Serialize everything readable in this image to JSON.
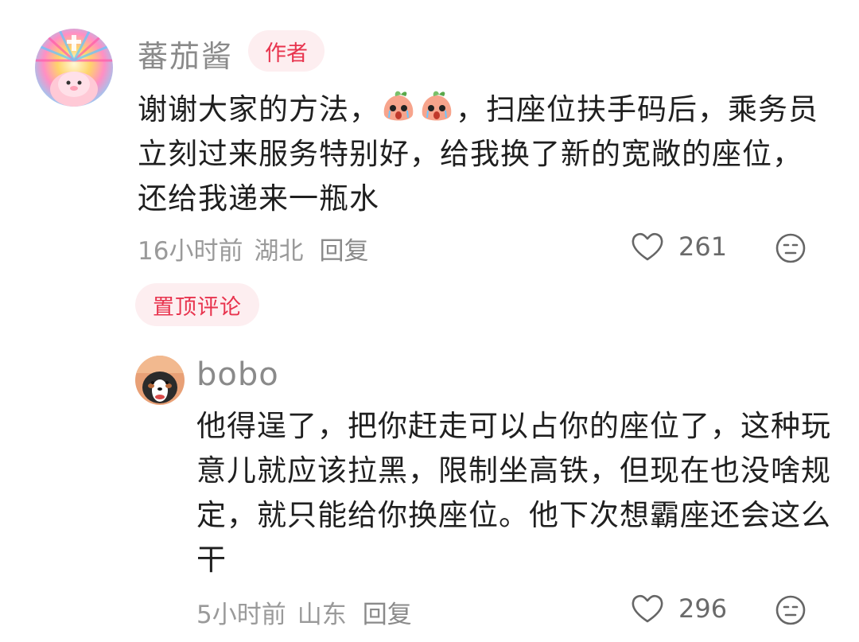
{
  "comment": {
    "author_name": "蕃茄酱",
    "author_badge": "作者",
    "text_part1": "谢谢大家的方法，",
    "text_part2": "，扫座位扶手码后，乘务员立刻过来服务特别好，给我换了新的宽敞的座位，还给我递来一瓶水",
    "time": "16小时前",
    "location": "湖北",
    "reply_label": "回复",
    "like_count": "261",
    "pinned_label": "置顶评论"
  },
  "reply": {
    "author_name": "bobo",
    "text": "他得逞了，把你赶走可以占你的座位了，这种玩意儿就应该拉黑，限制坐高铁，但现在也没啥规定，就只能给你换座位。他下次想霸座还会这么干",
    "time": "5小时前",
    "location": "山东",
    "reply_label": "回复",
    "like_count": "296"
  },
  "icons": {
    "like": "heart-outline-icon",
    "dislike": "frown-face-icon",
    "sticker": "crying-peach-sticker-icon"
  },
  "colors": {
    "accent_red": "#e8344e",
    "badge_bg": "#fdeef0",
    "meta_gray": "#9a9a9a"
  }
}
